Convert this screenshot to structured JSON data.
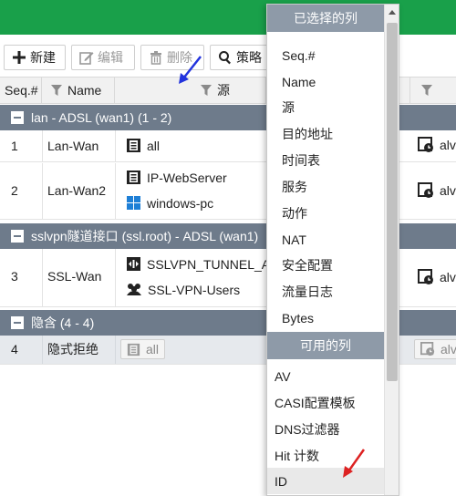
{
  "toolbar": {
    "new_label": "新建",
    "edit_label": "编辑",
    "delete_label": "删除",
    "policy_label": "策略"
  },
  "table": {
    "headers": {
      "seq": "Seq.#",
      "name": "Name",
      "source": "源"
    },
    "groups": [
      {
        "label": "lan - ADSL (wan1) (1 - 2)"
      },
      {
        "label": "sslvpn隧道接口 (ssl.root) - ADSL (wan1)"
      },
      {
        "label": "隐含 (4 - 4)"
      }
    ],
    "rows": [
      {
        "seq": "1",
        "name": "Lan-Wan",
        "sources": [
          "all"
        ],
        "schedule": "alv"
      },
      {
        "seq": "2",
        "name": "Lan-Wan2",
        "sources": [
          "IP-WebServer",
          "windows-pc"
        ],
        "schedule": "alv"
      },
      {
        "seq": "3",
        "name": "SSL-Wan",
        "sources": [
          "SSLVPN_TUNNEL_A",
          "SSL-VPN-Users"
        ],
        "schedule": "alv"
      },
      {
        "seq": "4",
        "name": "隐式拒绝",
        "sources": [
          "all"
        ],
        "schedule": "alv"
      }
    ]
  },
  "column_menu": {
    "selected_header": "已选择的列",
    "selected": [
      "Seq.#",
      "Name",
      "源",
      "目的地址",
      "时间表",
      "服务",
      "动作",
      "NAT",
      "安全配置",
      "流量日志",
      "Bytes"
    ],
    "available_header": "可用的列",
    "available": [
      "AV",
      "CASI配置模板",
      "DNS过滤器",
      "Hit 计数",
      "ID"
    ]
  },
  "colors": {
    "topbar": "#19a04a",
    "group_row": "#6e7b8b",
    "menu_header": "#8e9aa8",
    "arrow_blue": "#2233dd",
    "arrow_red": "#dd2222"
  }
}
